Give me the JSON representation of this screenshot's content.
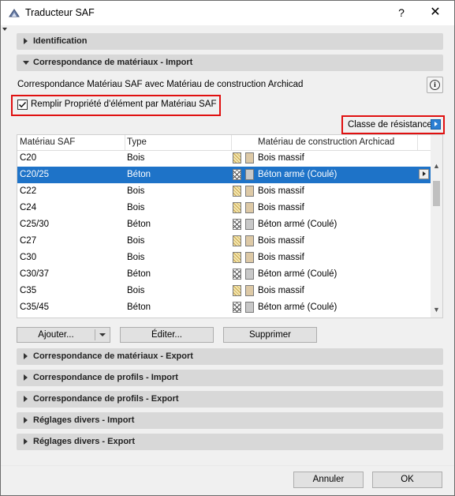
{
  "window": {
    "title": "Traducteur SAF",
    "help_label": "?",
    "close_label": "✕"
  },
  "sections_top": [
    {
      "label": "Identification",
      "expanded": false
    },
    {
      "label": "Correspondance de matériaux - Import",
      "expanded": true
    }
  ],
  "import": {
    "description": "Correspondance Matériau SAF avec Matériau de construction Archicad",
    "info_label": "i",
    "checkbox_label": "Remplir Propriété d'élément par Matériau SAF",
    "checkbox_checked": true,
    "classe_label": "Classe de résistance",
    "columns": [
      "Matériau SAF",
      "Type",
      "Matériau de construction Archicad"
    ],
    "rows": [
      {
        "saf": "C20",
        "type": "Bois",
        "pattern": "hatch",
        "color": "tan",
        "archicad": "Bois massif",
        "selected": false
      },
      {
        "saf": "C20/25",
        "type": "Béton",
        "pattern": "cross",
        "color": "gray",
        "archicad": "Béton armé (Coulé)",
        "selected": true
      },
      {
        "saf": "C22",
        "type": "Bois",
        "pattern": "hatch",
        "color": "tan",
        "archicad": "Bois massif",
        "selected": false
      },
      {
        "saf": "C24",
        "type": "Bois",
        "pattern": "hatch",
        "color": "tan",
        "archicad": "Bois massif",
        "selected": false
      },
      {
        "saf": "C25/30",
        "type": "Béton",
        "pattern": "cross",
        "color": "gray",
        "archicad": "Béton armé (Coulé)",
        "selected": false
      },
      {
        "saf": "C27",
        "type": "Bois",
        "pattern": "hatch",
        "color": "tan",
        "archicad": "Bois massif",
        "selected": false
      },
      {
        "saf": "C30",
        "type": "Bois",
        "pattern": "hatch",
        "color": "tan",
        "archicad": "Bois massif",
        "selected": false
      },
      {
        "saf": "C30/37",
        "type": "Béton",
        "pattern": "cross",
        "color": "gray",
        "archicad": "Béton armé (Coulé)",
        "selected": false
      },
      {
        "saf": "C35",
        "type": "Bois",
        "pattern": "hatch",
        "color": "tan",
        "archicad": "Bois massif",
        "selected": false
      },
      {
        "saf": "C35/45",
        "type": "Béton",
        "pattern": "cross",
        "color": "gray",
        "archicad": "Béton armé (Coulé)",
        "selected": false
      }
    ],
    "buttons": {
      "add": "Ajouter...",
      "edit": "Éditer...",
      "delete": "Supprimer"
    }
  },
  "sections_bottom": [
    {
      "label": "Correspondance de matériaux - Export",
      "expanded": false
    },
    {
      "label": "Correspondance de profils - Import",
      "expanded": false
    },
    {
      "label": "Correspondance de profils - Export",
      "expanded": false
    },
    {
      "label": "Réglages divers - Import",
      "expanded": false
    },
    {
      "label": "Réglages divers - Export",
      "expanded": false
    }
  ],
  "footer": {
    "cancel": "Annuler",
    "ok": "OK"
  },
  "colors": {
    "selection": "#1e73c8",
    "highlight_border": "#e01010",
    "section_bg": "#d8d8d8"
  }
}
